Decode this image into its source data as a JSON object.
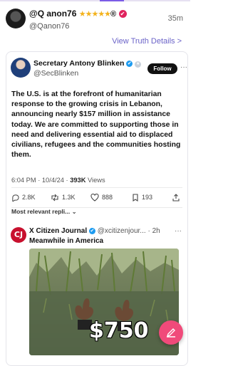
{
  "header": {
    "name": "@Q anon76",
    "stars": "★★★★★",
    "reg_symbol": "®",
    "handle": "@Qanon76",
    "time": "35m"
  },
  "view_details": "View Truth Details >",
  "post": {
    "author_name": "Secretary Antony Blinken",
    "author_handle": "@SecBlinken",
    "follow_label": "Follow",
    "more": "···",
    "text": "The U.S. is at the forefront of humanitarian response to the growing crisis in Lebanon, announcing nearly $157 million in assistance today. We are committed to supporting those in need and delivering essential aid to displaced civilians, refugees and the communities hosting them.",
    "time": "6:04 PM",
    "date": "10/4/24",
    "views": "393K",
    "views_label": "Views",
    "stats": {
      "replies": "2.8K",
      "reposts": "1.3K",
      "likes": "888",
      "bookmarks": "193"
    },
    "replies_filter": "Most relevant repli..."
  },
  "reply": {
    "logo_text": "CJ",
    "name": "X Citizen Journal",
    "handle": "@xcitizenjour...",
    "time": "2h",
    "text": "Meanwhile in America",
    "image_caption": "$750",
    "more": "···"
  },
  "colors": {
    "accent": "#6b63c8",
    "badge": "#e0245e",
    "fab": "#f04a7a"
  }
}
